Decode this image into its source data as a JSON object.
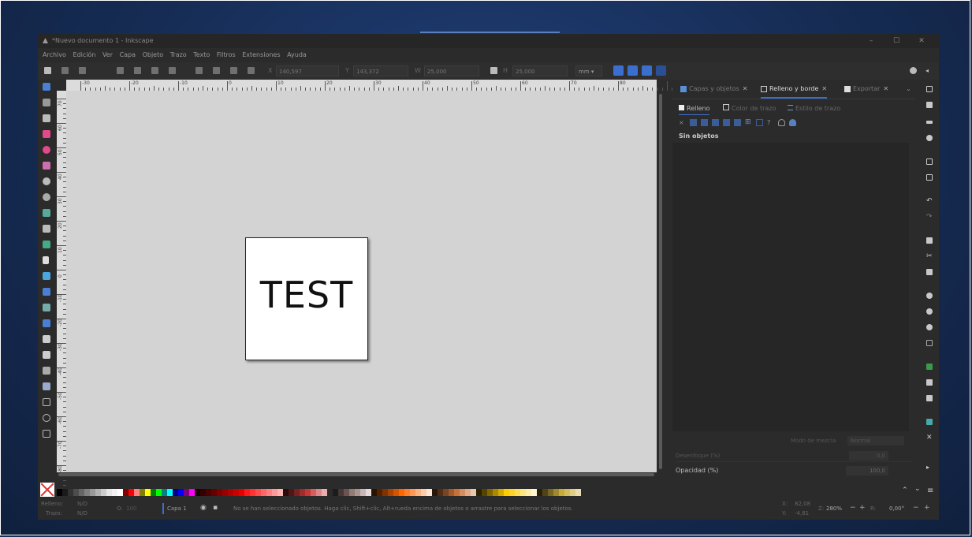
{
  "window": {
    "title": "*Nuevo documento 1 - Inkscape",
    "controls": [
      "–",
      "☐",
      "✕"
    ]
  },
  "menu": [
    "Archivo",
    "Edición",
    "Ver",
    "Capa",
    "Objeto",
    "Trazo",
    "Texto",
    "Filtros",
    "Extensiones",
    "Ayuda"
  ],
  "toolbar": {
    "x_label": "X",
    "x_value": "140,597",
    "y_label": "Y",
    "y_value": "143,372",
    "w_label": "W",
    "w_value": "25,000",
    "h_label": "H",
    "h_value": "25,000",
    "unit": "mm ▾"
  },
  "ruler": {
    "h_ticks": [
      "-30",
      "-20",
      "-10",
      "0",
      "10",
      "20",
      "30",
      "40",
      "50",
      "60",
      "70",
      "80"
    ],
    "v_ticks": [
      "70",
      "60",
      "50",
      "40",
      "30",
      "20",
      "10",
      "0",
      "-10",
      "-20",
      "-30",
      "-40",
      "-50",
      "-60",
      "-70",
      "-80",
      "-90"
    ]
  },
  "canvas": {
    "text": "TEST"
  },
  "panel": {
    "tabs": [
      {
        "label": "Capas y objetos",
        "close": "✕"
      },
      {
        "label": "Relleno y borde",
        "close": "✕"
      },
      {
        "label": "Exportar",
        "close": "✕"
      }
    ],
    "subtabs": [
      "Relleno",
      "Color de trazo",
      "Estilo de trazo"
    ],
    "empty_message": "Sin objetos",
    "blend_label": "Modo de mezcla",
    "blend_value": "Normal",
    "blur_label": "Desenfoque (%)",
    "blur_value": "0,0",
    "opacity_label": "Opacidad (%)",
    "opacity_value": "100,0"
  },
  "status": {
    "fill_label": "Relleno:",
    "fill_value": "N/D",
    "stroke_label": "Trazo:",
    "stroke_value": "N/D",
    "opacity_label": "O:",
    "opacity_value": "100",
    "layer": "Capa 1",
    "message": "No se han seleccionado objetos. Haga clic, Shift+clic, Alt+rueda encima de objetos o arrastre para seleccionar los objetos.",
    "x_label": "X:",
    "x_value": "82,08",
    "y_label": "Y:",
    "y_value": "-4,81",
    "zoom_label": "Z:",
    "zoom_value": "280%",
    "rot_label": "R:",
    "rot_value": "0,00°"
  },
  "colors": {
    "accent": "#3b6fcf",
    "canvas_bg": "#d3d3d3",
    "ui_bg": "#2b2b2b"
  }
}
